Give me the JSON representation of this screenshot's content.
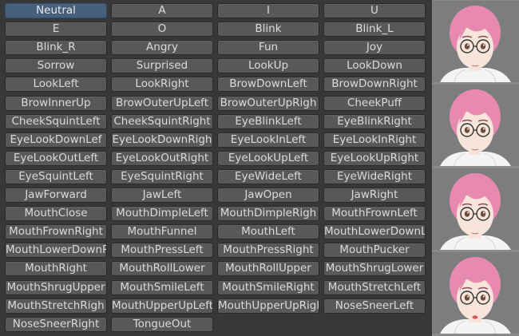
{
  "blendshape_buttons": [
    "Neutral",
    "A",
    "I",
    "U",
    "E",
    "O",
    "Blink",
    "Blink_L",
    "Blink_R",
    "Angry",
    "Fun",
    "Joy",
    "Sorrow",
    "Surprised",
    "LookUp",
    "LookDown",
    "LookLeft",
    "LookRight",
    "BrowDownLeft",
    "BrowDownRight",
    "BrowInnerUp",
    "BrowOuterUpLeft",
    "BrowOuterUpRigh",
    "CheekPuff",
    "CheekSquintLeft",
    "CheekSquintRight",
    "EyeBlinkLeft",
    "EyeBlinkRight",
    "EyeLookDownLef",
    "EyeLookDownRigh",
    "EyeLookInLeft",
    "EyeLookInRight",
    "EyeLookOutLeft",
    "EyeLookOutRight",
    "EyeLookUpLeft",
    "EyeLookUpRight",
    "EyeSquintLeft",
    "EyeSquintRight",
    "EyeWideLeft",
    "EyeWideRight",
    "JawForward",
    "JawLeft",
    "JawOpen",
    "JawRight",
    "MouthClose",
    "MouthDimpleLeft",
    "MouthDimpleRigh",
    "MouthFrownLeft",
    "MouthFrownRight",
    "MouthFunnel",
    "MouthLeft",
    "MouthLowerDownL",
    "MouthLowerDownRi",
    "MouthPressLeft",
    "MouthPressRight",
    "MouthPucker",
    "MouthRight",
    "MouthRollLower",
    "MouthRollUpper",
    "MouthShrugLower",
    "MouthShrugUpper",
    "MouthSmileLeft",
    "MouthSmileRight",
    "MouthStretchLeft",
    "MouthStretchRigh",
    "MouthUpperUpLeft",
    "MouthUpperUpRigh",
    "NoseSneerLeft",
    "NoseSneerRight",
    "TongueOut"
  ],
  "selected": "Neutral",
  "colors": {
    "panel_bg": "#383838",
    "button_bg": "#585858",
    "button_selected_bg": "#46607c",
    "button_text": "#dadada",
    "preview_bg": "#7d7d7d",
    "hair": "#e88ab0",
    "skin": "#f7e4da",
    "hoodie": "#f4f4f4"
  },
  "preview_icons": [
    "avatar-preview-1",
    "avatar-preview-2",
    "avatar-preview-3",
    "avatar-preview-4"
  ]
}
